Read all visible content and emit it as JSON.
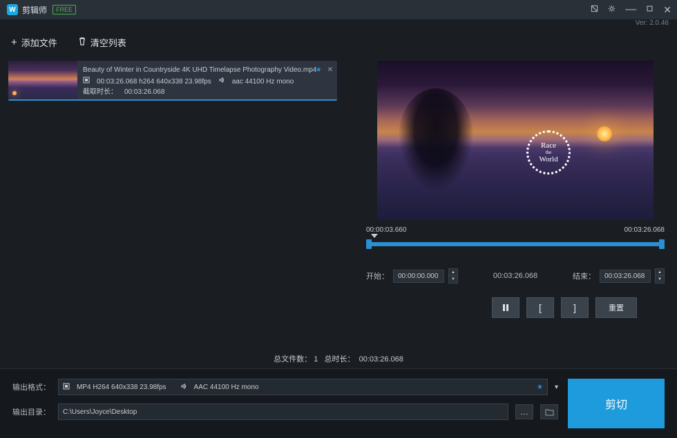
{
  "titlebar": {
    "app_name": "剪辑师",
    "badge": "FREE",
    "version": "Ver: 2.0.46"
  },
  "toolbar": {
    "add_file": "添加文件",
    "clear_list": "清空列表"
  },
  "file": {
    "name": "Beauty of Winter in Countryside 4K UHD Timelapse Photography Video.mp4",
    "video_info": "00:03:26.068 h264 640x338 23.98fps",
    "audio_info": "aac 44100 Hz mono",
    "cut_label": "截取时长：",
    "cut_duration": "00:03:26.068"
  },
  "preview": {
    "watermark_line1": "Race",
    "watermark_line2": "the",
    "watermark_line3": "World"
  },
  "timeline": {
    "start_time": "00:00:03.660",
    "end_time": "00:03:26.068"
  },
  "controls": {
    "start_label": "开始：",
    "start_value": "00:00:00.000",
    "current_time": "00:03:26.068",
    "end_label": "结束：",
    "end_value": "00:03:26.068",
    "reset_label": "重置"
  },
  "status": {
    "count_label": "总文件数：",
    "count": "1",
    "duration_label": "总时长：",
    "duration": "00:03:26.068"
  },
  "output": {
    "format_label": "输出格式：",
    "video_format": "MP4 H264 640x338 23.98fps",
    "audio_format": "AAC 44100 Hz mono",
    "dir_label": "输出目录：",
    "dir_value": "C:\\Users\\Joyce\\Desktop",
    "cut_button": "剪切"
  }
}
